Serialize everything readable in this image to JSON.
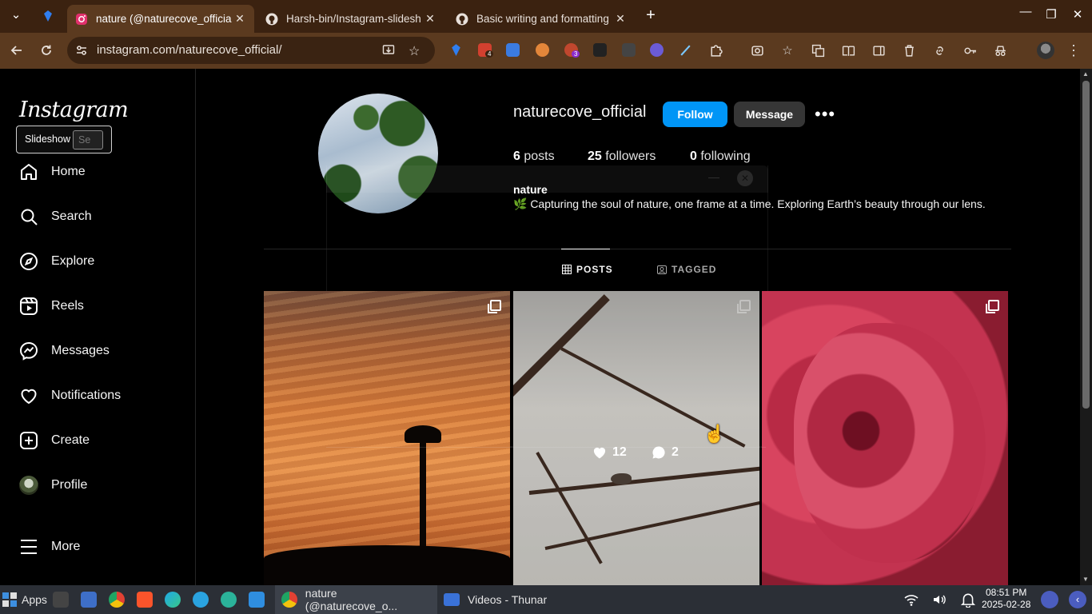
{
  "browser": {
    "tabs": [
      {
        "title": "nature (@naturecove_officia",
        "favicon": "instagram-icon",
        "active": true
      },
      {
        "title": "Harsh-bin/Instagram-slidesh",
        "favicon": "github-icon",
        "active": false
      },
      {
        "title": "Basic writing and formatting",
        "favicon": "github-icon",
        "active": false
      }
    ],
    "url": "instagram.com/naturecove_official/",
    "extension_badges": [
      "4",
      "3"
    ]
  },
  "sidebar": {
    "logo": "Instagram",
    "slideshow": {
      "label": "Slideshow",
      "placeholder": "Se"
    },
    "items": [
      {
        "label": "Home",
        "icon": "home-icon"
      },
      {
        "label": "Search",
        "icon": "search-icon"
      },
      {
        "label": "Explore",
        "icon": "compass-icon"
      },
      {
        "label": "Reels",
        "icon": "reels-icon"
      },
      {
        "label": "Messages",
        "icon": "messenger-icon"
      },
      {
        "label": "Notifications",
        "icon": "heart-icon"
      },
      {
        "label": "Create",
        "icon": "plus-square-icon"
      },
      {
        "label": "Profile",
        "icon": "avatar"
      },
      {
        "label": "More",
        "icon": "hamburger-icon"
      }
    ]
  },
  "profile": {
    "username": "naturecove_official",
    "follow_label": "Follow",
    "message_label": "Message",
    "stats": {
      "posts_count": "6",
      "posts_label": "posts",
      "followers_count": "25",
      "followers_label": "followers",
      "following_count": "0",
      "following_label": "following"
    },
    "full_name": "nature",
    "bio": "🌿 Capturing the soul of nature, one frame at a time. Exploring Earth’s beauty through our lens.",
    "tabs": {
      "posts": "POSTS",
      "tagged": "TAGGED"
    },
    "hovered_post": {
      "likes": "12",
      "comments": "2"
    }
  },
  "taskbar": {
    "apps_label": "Apps",
    "tasks": [
      {
        "title": "nature (@naturecove_o...",
        "active": true
      },
      {
        "title": "Videos - Thunar",
        "active": false
      }
    ],
    "time": "08:51 PM",
    "date": "2025-02-28"
  },
  "colors": {
    "follow_button": "#0095f6",
    "message_button": "#363636",
    "tab_active": "#5b3a1f",
    "tabstrip": "#3b2210"
  }
}
